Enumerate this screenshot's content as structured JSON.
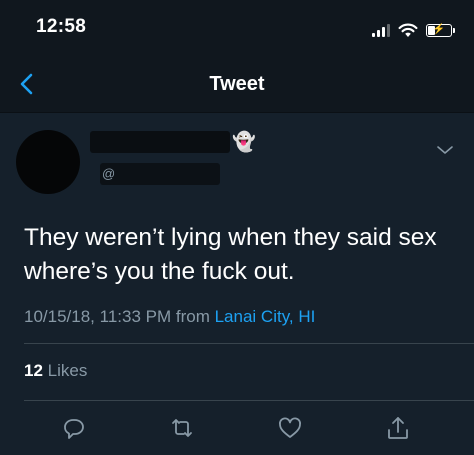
{
  "status_bar": {
    "time": "12:58",
    "signal_bars": 3,
    "battery_level": 0.3,
    "charging": true,
    "icons": [
      "signal-icon",
      "wifi-icon",
      "battery-charging-icon"
    ]
  },
  "nav": {
    "title": "Tweet",
    "back_icon": "chevron-left-icon",
    "accent_color": "#1da1f2"
  },
  "tweet": {
    "author": {
      "handle_prefix": "@",
      "emoji": "👻",
      "redacted": true
    },
    "text": "They weren’t lying when they said sex where’s you the fuck out.",
    "timestamp": "10/15/18, 11:33 PM",
    "from_label": "from",
    "location": "Lanai City, HI",
    "likes_count": "12",
    "likes_label": "Likes"
  },
  "actions": [
    {
      "name": "reply-button",
      "icon": "reply-icon"
    },
    {
      "name": "retweet-button",
      "icon": "retweet-icon"
    },
    {
      "name": "like-button",
      "icon": "heart-icon"
    },
    {
      "name": "share-button",
      "icon": "share-icon"
    }
  ],
  "colors": {
    "background": "#15202b",
    "bar_background": "#10171e",
    "secondary_text": "#8899a6",
    "divider": "#38444d",
    "link": "#1da1f2"
  }
}
